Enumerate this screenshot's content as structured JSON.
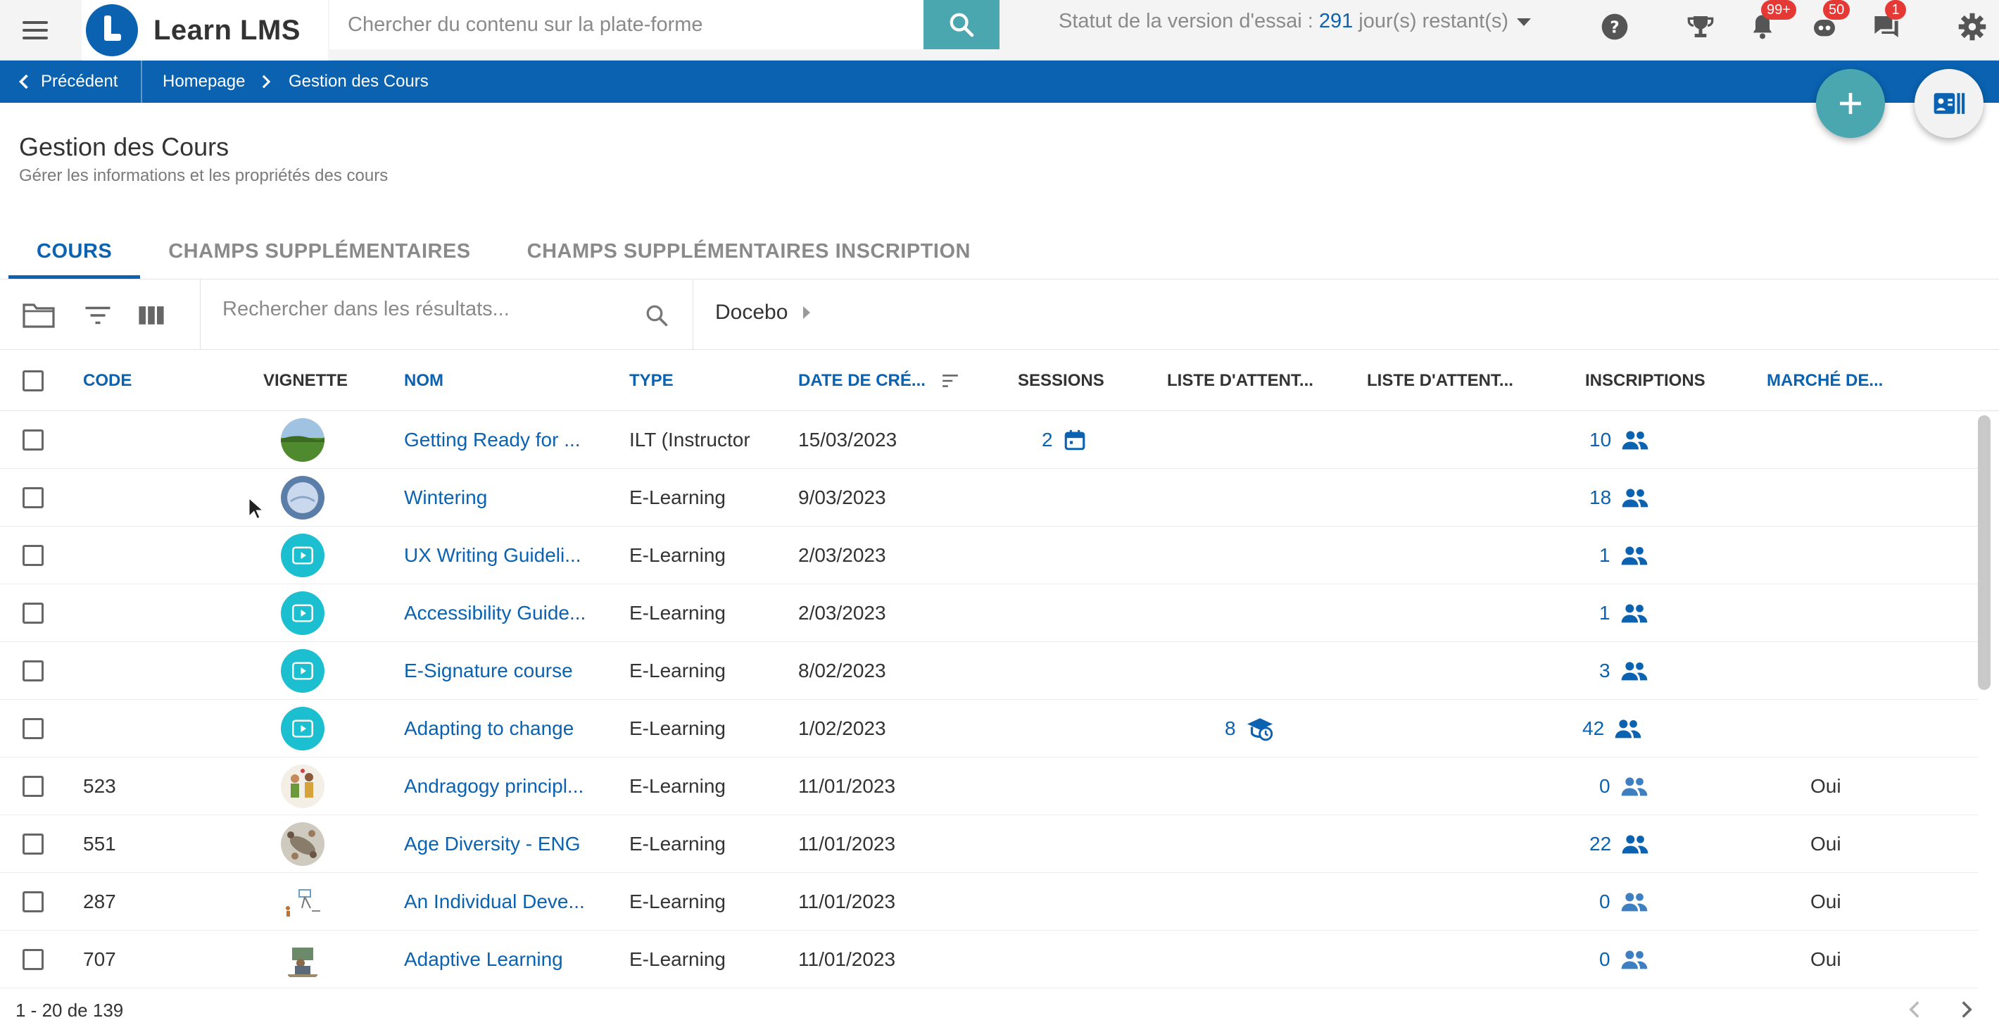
{
  "header": {
    "logo_text": "Learn LMS",
    "search_placeholder": "Chercher du contenu sur la plate-forme",
    "trial_prefix": "Statut de la version d'essai : ",
    "trial_days": "291",
    "trial_suffix": " jour(s) restant(s)",
    "notifications_badge": "99+",
    "chat_badge": "50",
    "messages_badge": "1"
  },
  "breadcrumb": {
    "back_label": "Précédent",
    "home_label": "Homepage",
    "current_label": "Gestion des Cours"
  },
  "page": {
    "title": "Gestion des Cours",
    "subtitle": "Gérer les informations et les propriétés des cours"
  },
  "tabs": [
    {
      "label": "COURS",
      "active": true
    },
    {
      "label": "CHAMPS SUPPLÉMENTAIRES",
      "active": false
    },
    {
      "label": "CHAMPS SUPPLÉMENTAIRES INSCRIPTION",
      "active": false
    }
  ],
  "toolbar": {
    "search_placeholder": "Rechercher dans les résultats...",
    "branch_label": "Docebo"
  },
  "table": {
    "columns": {
      "code": "CODE",
      "thumbnail": "VIGNETTE",
      "name": "NOM",
      "type": "TYPE",
      "created": "DATE DE CRÉ...",
      "sessions": "SESSIONS",
      "waitlist1": "LISTE D'ATTENT...",
      "waitlist2": "LISTE D'ATTENT...",
      "enrollments": "INSCRIPTIONS",
      "marketplace": "MARCHÉ DE..."
    },
    "rows": [
      {
        "code": "",
        "thumb": "landscape",
        "name": "Getting Ready for ...",
        "type": "ILT (Instructor",
        "date": "15/03/2023",
        "sessions": "2",
        "waitlist": "",
        "enrollments": "10",
        "market": ""
      },
      {
        "code": "",
        "thumb": "globe",
        "name": "Wintering",
        "type": "E-Learning",
        "date": "9/03/2023",
        "sessions": "",
        "waitlist": "",
        "enrollments": "18",
        "market": ""
      },
      {
        "code": "",
        "thumb": "play",
        "name": "UX Writing Guideli...",
        "type": "E-Learning",
        "date": "2/03/2023",
        "sessions": "",
        "waitlist": "",
        "enrollments": "1",
        "market": ""
      },
      {
        "code": "",
        "thumb": "play",
        "name": "Accessibility Guide...",
        "type": "E-Learning",
        "date": "2/03/2023",
        "sessions": "",
        "waitlist": "",
        "enrollments": "1",
        "market": ""
      },
      {
        "code": "",
        "thumb": "play",
        "name": "E-Signature course",
        "type": "E-Learning",
        "date": "8/02/2023",
        "sessions": "",
        "waitlist": "",
        "enrollments": "3",
        "market": ""
      },
      {
        "code": "",
        "thumb": "play",
        "name": "Adapting to change",
        "type": "E-Learning",
        "date": "1/02/2023",
        "sessions": "",
        "waitlist": "8",
        "enrollments": "42",
        "market": ""
      },
      {
        "code": "523",
        "thumb": "people",
        "name": "Andragogy principl...",
        "type": "E-Learning",
        "date": "11/01/2023",
        "sessions": "",
        "waitlist": "",
        "enrollments": "0",
        "market": "Oui"
      },
      {
        "code": "551",
        "thumb": "meeting",
        "name": "Age Diversity - ENG",
        "type": "E-Learning",
        "date": "11/01/2023",
        "sessions": "",
        "waitlist": "",
        "enrollments": "22",
        "market": "Oui"
      },
      {
        "code": "287",
        "thumb": "sketch",
        "name": "An Individual Deve...",
        "type": "E-Learning",
        "date": "11/01/2023",
        "sessions": "",
        "waitlist": "",
        "enrollments": "0",
        "market": "Oui"
      },
      {
        "code": "707",
        "thumb": "desk",
        "name": "Adaptive Learning",
        "type": "E-Learning",
        "date": "11/01/2023",
        "sessions": "",
        "waitlist": "",
        "enrollments": "0",
        "market": "Oui"
      }
    ]
  },
  "footer": {
    "count_label": "1 - 20 de 139"
  },
  "colors": {
    "primary": "#0a62b0",
    "teal": "#4aa7b0",
    "badge": "#e53935"
  }
}
